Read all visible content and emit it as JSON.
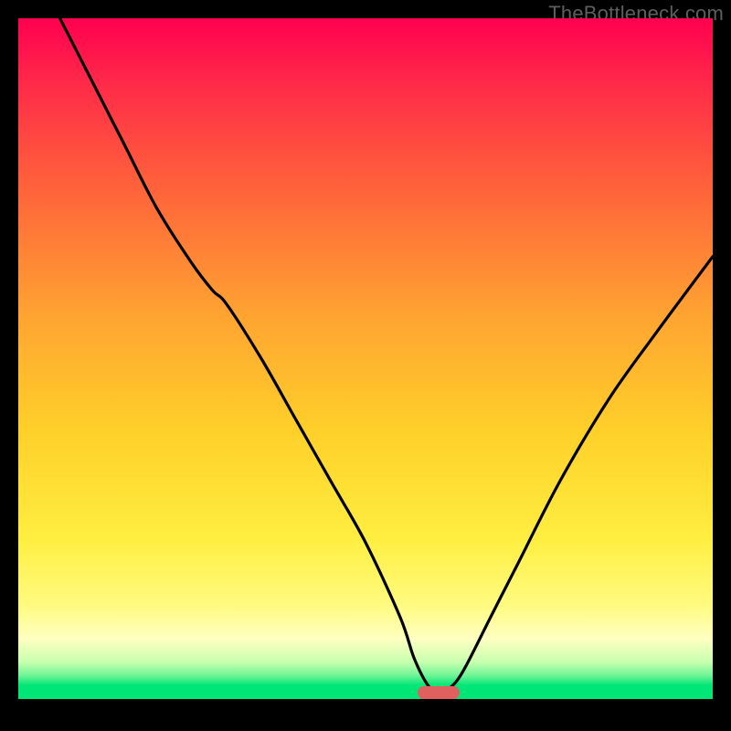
{
  "attribution": "TheBottleneck.com",
  "palette": {
    "black": "#000000",
    "marker": "#e06060",
    "green": "#00e676",
    "gradient_stops": [
      {
        "pos": 0.0,
        "color": "#ff0050"
      },
      {
        "pos": 0.1,
        "color": "#ff2b48"
      },
      {
        "pos": 0.25,
        "color": "#ff613b"
      },
      {
        "pos": 0.45,
        "color": "#ffa531"
      },
      {
        "pos": 0.62,
        "color": "#ffd029"
      },
      {
        "pos": 0.78,
        "color": "#ffee40"
      },
      {
        "pos": 0.88,
        "color": "#fffb80"
      },
      {
        "pos": 0.93,
        "color": "#ffffc0"
      },
      {
        "pos": 0.965,
        "color": "#c8ffb0"
      },
      {
        "pos": 0.985,
        "color": "#70f596"
      },
      {
        "pos": 1.0,
        "color": "#00e676"
      }
    ]
  },
  "chart_data": {
    "type": "line",
    "title": "",
    "xlabel": "",
    "ylabel": "",
    "xlim": [
      0,
      100
    ],
    "ylim": [
      0,
      100
    ],
    "series": [
      {
        "name": "bottleneck-curve",
        "x": [
          6,
          10,
          15,
          20,
          25,
          28,
          30,
          35,
          40,
          45,
          50,
          55,
          57,
          59,
          60.5,
          62,
          64,
          68,
          72,
          78,
          85,
          92,
          100
        ],
        "y": [
          100,
          92,
          82,
          72,
          64,
          60,
          58,
          50,
          41,
          32,
          23,
          12,
          6,
          2,
          1,
          1.5,
          4,
          12,
          20,
          32,
          44,
          54,
          65
        ]
      }
    ],
    "annotations": [
      {
        "name": "optimal-marker",
        "x": 60.5,
        "y": 1,
        "shape": "pill"
      }
    ]
  }
}
